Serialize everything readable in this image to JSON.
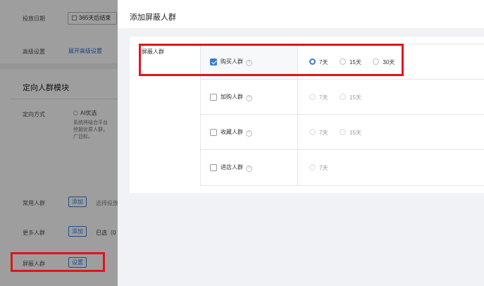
{
  "background": {
    "launch_date_label": "投放日期",
    "launch_date_value": "365天后结束",
    "advanced_label": "高级设置",
    "advanced_link": "展开高级设置",
    "section_title": "定向人群模块",
    "targeting_label": "定向方式",
    "ai_option": "AI优选",
    "ai_desc": "系统将结合平台\n挖掘优质人群，\n广目标。",
    "common_label": "常用人群",
    "common_add": "添加",
    "common_hint": "选择投放",
    "more_label": "更多人群",
    "more_add": "添加",
    "more_selected": "已选（0",
    "block_label": "屏蔽人群",
    "block_button": "设置"
  },
  "drawer": {
    "title": "添加屏蔽人群",
    "field_label": "屏蔽人群",
    "rows": [
      {
        "label": "购买人群",
        "checked": true,
        "options": [
          "7天",
          "15天",
          "30天"
        ],
        "selected": "7天"
      },
      {
        "label": "加购人群",
        "checked": false,
        "options": [
          "7天",
          "15天"
        ],
        "selected": ""
      },
      {
        "label": "收藏人群",
        "checked": false,
        "options": [
          "7天",
          "15天"
        ],
        "selected": ""
      },
      {
        "label": "进店人群",
        "checked": false,
        "options": [
          "7天"
        ],
        "selected": ""
      }
    ]
  },
  "colors": {
    "accent": "#3a7bd5",
    "highlight": "#e0151c"
  }
}
